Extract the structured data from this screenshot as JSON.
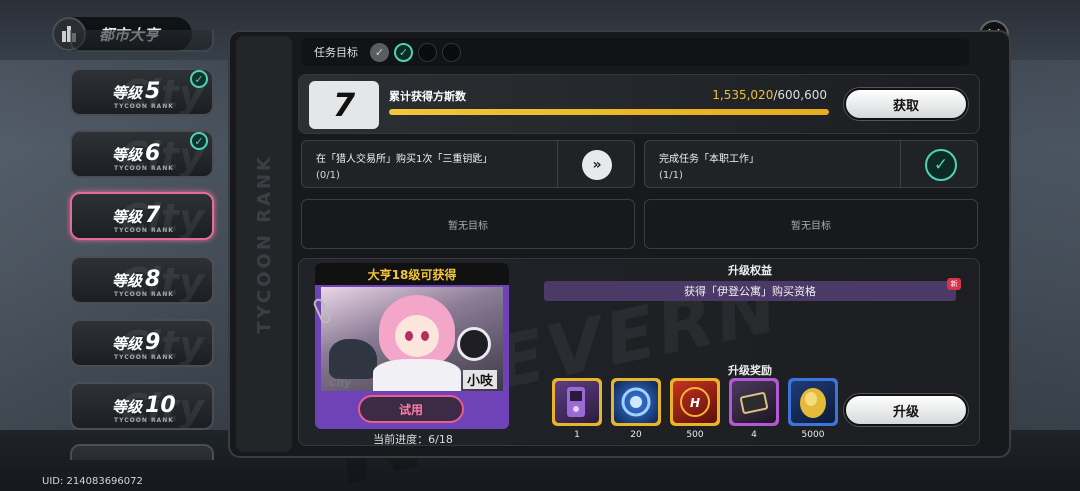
{
  "header": {
    "title": "都市大亨",
    "close_label": "✕"
  },
  "uid": "UID: 214083696072",
  "rank_list": {
    "items": [
      {
        "prefix": "等级",
        "level": "5",
        "sub": "TYCOON RANK",
        "completed": true,
        "active": false
      },
      {
        "prefix": "等级",
        "level": "6",
        "sub": "TYCOON RANK",
        "completed": true,
        "active": false
      },
      {
        "prefix": "等级",
        "level": "7",
        "sub": "TYCOON RANK",
        "completed": false,
        "active": true
      },
      {
        "prefix": "等级",
        "level": "8",
        "sub": "TYCOON RANK",
        "completed": false,
        "active": false
      },
      {
        "prefix": "等级",
        "level": "9",
        "sub": "TYCOON RANK",
        "completed": false,
        "active": false
      },
      {
        "prefix": "等级",
        "level": "10",
        "sub": "TYCOON RANK",
        "completed": false,
        "active": false
      }
    ]
  },
  "spine_text": "TYCOON RANK",
  "objectives": {
    "label": "任务目标",
    "statuses": [
      "done",
      "current",
      "todo",
      "todo"
    ]
  },
  "level_card": {
    "level": "7",
    "progress_label": "累计获得方斯数",
    "current": "1,535,020",
    "target": "/600,600",
    "progress_fraction": 1.0,
    "claim_label": "获取"
  },
  "tasks": [
    {
      "title": "在「猎人交易所」购买1次「三重钥匙」",
      "progress": "(0/1)",
      "done": false,
      "action_icon": "double-chevron-right-icon"
    },
    {
      "title": "完成任务「本职工作」",
      "progress": "(1/1)",
      "done": true,
      "action_icon": "check-icon"
    }
  ],
  "empty_slots": [
    "暂无目标",
    "暂无目标"
  ],
  "reward_card": {
    "header": "大亨18级可获得",
    "character_name": "小吱",
    "trial_label": "试用",
    "progress_text": "当前进度：6/18"
  },
  "upgrade": {
    "benefits_title": "升级权益",
    "benefit_text": "获得「伊登公寓」购买资格",
    "new_badge": "新",
    "rewards_title": "升级奖励",
    "rewards": [
      {
        "icon": "purple-device-icon",
        "qty": "1",
        "rarity_color": "#e7b42a"
      },
      {
        "icon": "blue-orb-icon",
        "qty": "20",
        "rarity_color": "#e7b42a"
      },
      {
        "icon": "hunter-card-icon",
        "qty": "500",
        "rarity_color": "#e7b42a"
      },
      {
        "icon": "chest-icon",
        "qty": "4",
        "rarity_color": "#b358d6"
      },
      {
        "icon": "gold-coin-icon",
        "qty": "5000",
        "rarity_color": "#3d74d8"
      }
    ],
    "upgrade_label": "升级"
  }
}
